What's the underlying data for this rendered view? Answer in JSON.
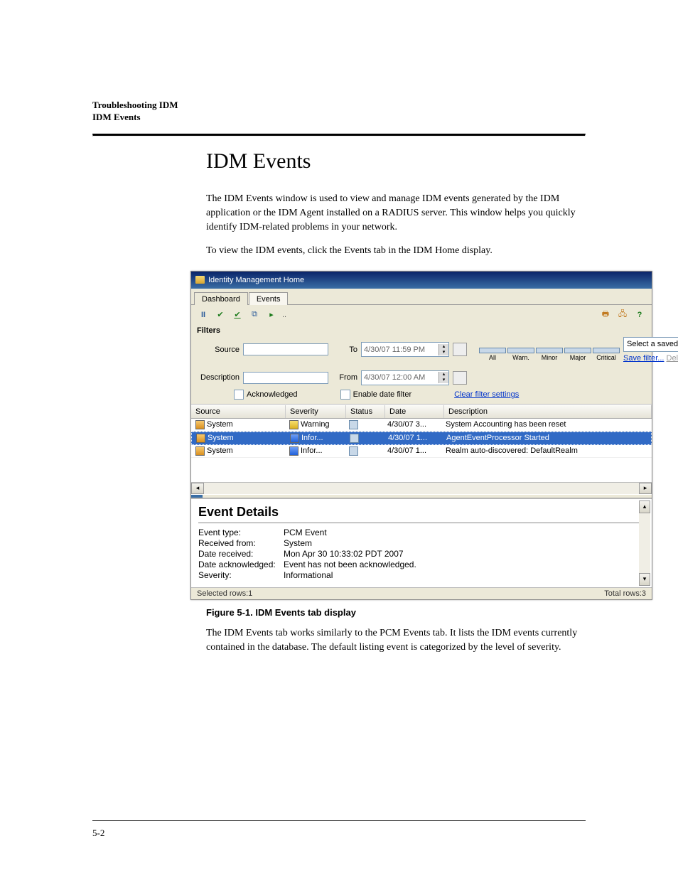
{
  "header": {
    "line1": "Troubleshooting IDM",
    "line2": "IDM Events"
  },
  "title": "IDM Events",
  "para1": "The IDM Events window is used to view and manage IDM events generated by the IDM application or the IDM Agent installed on a RADIUS server. This window helps you quickly identify IDM-related problems in your network.",
  "para2": "To view the IDM events, click the Events tab in the IDM Home display.",
  "figcaption": "Figure 5-1. IDM Events tab display",
  "para3": "The IDM Events tab works similarly to the PCM Events tab. It lists the IDM events currently contained in the database. The default listing event is categorized by the level of severity.",
  "pagefoot": "5-2",
  "window": {
    "title": "Identity Management Home",
    "tabs": {
      "dashboard": "Dashboard",
      "events": "Events"
    },
    "filters": {
      "label": "Filters",
      "source_lbl": "Source",
      "desc_lbl": "Description",
      "to_lbl": "To",
      "from_lbl": "From",
      "to_val": "4/30/07 11:59 PM",
      "from_val": "4/30/07 12:00 AM",
      "ack": "Acknowledged",
      "enable_date": "Enable date filter",
      "clear": "Clear filter settings",
      "sev": {
        "all": "All",
        "warn": "Warn.",
        "minor": "Minor",
        "major": "Major",
        "critical": "Critical"
      },
      "select_saved": "Select a saved filter",
      "save_link": "Save filter...",
      "delete_link": "Delete filters..."
    },
    "cols": {
      "source": "Source",
      "severity": "Severity",
      "status": "Status",
      "date": "Date",
      "description": "Description"
    },
    "rows": [
      {
        "source": "System",
        "severity": "Warning",
        "date": "4/30/07 3...",
        "desc": "System Accounting has been reset"
      },
      {
        "source": "System",
        "severity": "Infor...",
        "date": "4/30/07 1...",
        "desc": "AgentEventProcessor Started"
      },
      {
        "source": "System",
        "severity": "Infor...",
        "date": "4/30/07 1...",
        "desc": "Realm auto-discovered: DefaultRealm"
      }
    ],
    "details": {
      "heading": "Event Details",
      "event_type_lbl": "Event type:",
      "event_type_val": "PCM Event",
      "received_from_lbl": "Received from:",
      "received_from_val": "System",
      "date_received_lbl": "Date received:",
      "date_received_val": "Mon Apr 30 10:33:02 PDT 2007",
      "date_ack_lbl": "Date acknowledged:",
      "date_ack_val": "Event has not been acknowledged.",
      "severity_lbl": "Severity:",
      "severity_val": "Informational"
    },
    "status": {
      "selected": "Selected rows:1",
      "total": "Total rows:3"
    }
  }
}
